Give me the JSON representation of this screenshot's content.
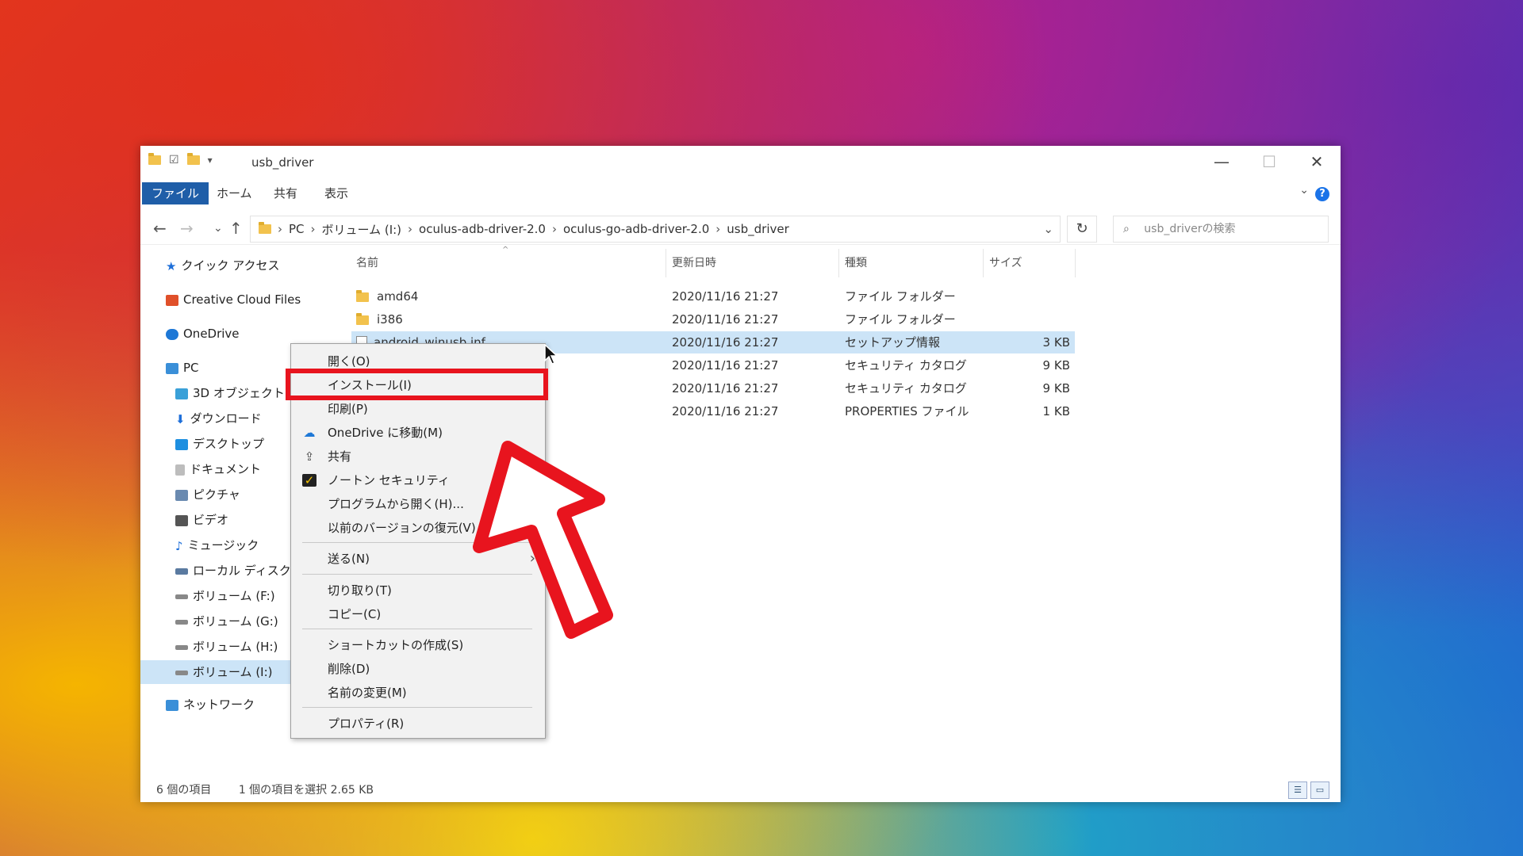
{
  "window": {
    "title": "usb_driver",
    "minimize": "—",
    "maximize": "☐",
    "close": "✕"
  },
  "ribbon": {
    "tabs": [
      "ファイル",
      "ホーム",
      "共有",
      "表示"
    ],
    "help": "?"
  },
  "address": {
    "back": "←",
    "forward": "→",
    "recent": "⌄",
    "up": "↑",
    "crumbs": [
      "PC",
      "ボリューム (I:)",
      "oculus-adb-driver-2.0",
      "oculus-go-adb-driver-2.0",
      "usb_driver"
    ],
    "refresh": "↻",
    "search_placeholder": "usb_driverの検索"
  },
  "nav": {
    "items": [
      {
        "label": "クイック アクセス",
        "icon": "star-icon",
        "color": "#1e6fd9"
      },
      {
        "label": "Creative Cloud Files",
        "icon": "creative-cloud-icon",
        "color": "#e0502a"
      },
      {
        "label": "OneDrive",
        "icon": "onedrive-icon",
        "color": "#1e78d6"
      },
      {
        "label": "PC",
        "icon": "pc-icon",
        "color": "#3a8fd8"
      },
      {
        "label": "3D オブジェクト",
        "icon": "cube-icon",
        "color": "#3aa0d8"
      },
      {
        "label": "ダウンロード",
        "icon": "download-icon",
        "color": "#1e6fd9"
      },
      {
        "label": "デスクトップ",
        "icon": "desktop-icon",
        "color": "#1e8fe0"
      },
      {
        "label": "ドキュメント",
        "icon": "document-icon",
        "color": "#8a8a8a"
      },
      {
        "label": "ピクチャ",
        "icon": "picture-icon",
        "color": "#6a8ab0"
      },
      {
        "label": "ビデオ",
        "icon": "video-icon",
        "color": "#555"
      },
      {
        "label": "ミュージック",
        "icon": "music-icon",
        "color": "#1e6fd9"
      },
      {
        "label": "ローカル ディスク (C",
        "icon": "disk-icon",
        "color": "#5a7aa0"
      },
      {
        "label": "ボリューム (F:)",
        "icon": "drive-icon",
        "color": "#777"
      },
      {
        "label": "ボリューム (G:)",
        "icon": "drive-icon",
        "color": "#777"
      },
      {
        "label": "ボリューム (H:)",
        "icon": "drive-icon",
        "color": "#777"
      },
      {
        "label": "ボリューム (I:)",
        "icon": "drive-icon",
        "color": "#777"
      },
      {
        "label": "ネットワーク",
        "icon": "network-icon",
        "color": "#3a8fd8"
      }
    ]
  },
  "columns": {
    "name": "名前",
    "date": "更新日時",
    "type": "種類",
    "size": "サイズ"
  },
  "files": [
    {
      "name": "amd64",
      "date": "2020/11/16 21:27",
      "type": "ファイル フォルダー",
      "size": "",
      "kind": "folder"
    },
    {
      "name": "i386",
      "date": "2020/11/16 21:27",
      "type": "ファイル フォルダー",
      "size": "",
      "kind": "folder"
    },
    {
      "name": "android_winusb.inf",
      "date": "2020/11/16 21:27",
      "type": "セットアップ情報",
      "size": "3 KB",
      "kind": "file"
    },
    {
      "name": "",
      "date": "2020/11/16 21:27",
      "type": "セキュリティ カタログ",
      "size": "9 KB",
      "kind": "file"
    },
    {
      "name": "",
      "date": "2020/11/16 21:27",
      "type": "セキュリティ カタログ",
      "size": "9 KB",
      "kind": "file"
    },
    {
      "name": "",
      "date": "2020/11/16 21:27",
      "type": "PROPERTIES ファイル",
      "size": "1 KB",
      "kind": "file"
    }
  ],
  "context_menu": {
    "items": [
      {
        "label": "開く(O)"
      },
      {
        "label": "インストール(I)"
      },
      {
        "label": "印刷(P)"
      },
      {
        "label": "OneDrive に移動(M)",
        "icon": "onedrive-icon"
      },
      {
        "label": "共有",
        "icon": "share-icon"
      },
      {
        "label": "ノートン セキュリティ",
        "icon": "norton-icon",
        "submenu": true
      },
      {
        "label": "プログラムから開く(H)..."
      },
      {
        "label": "以前のバージョンの復元(V)"
      },
      {
        "label": "送る(N)",
        "submenu": true
      },
      {
        "label": "切り取り(T)"
      },
      {
        "label": "コピー(C)"
      },
      {
        "label": "ショートカットの作成(S)"
      },
      {
        "label": "削除(D)"
      },
      {
        "label": "名前の変更(M)"
      },
      {
        "label": "プロパティ(R)"
      }
    ]
  },
  "status": {
    "count": "6 個の項目",
    "selected": "1 個の項目を選択 2.65 KB"
  },
  "colors": {
    "accent": "#1f5ea8",
    "selection": "#cce4f7",
    "highlight": "#e8141e"
  }
}
